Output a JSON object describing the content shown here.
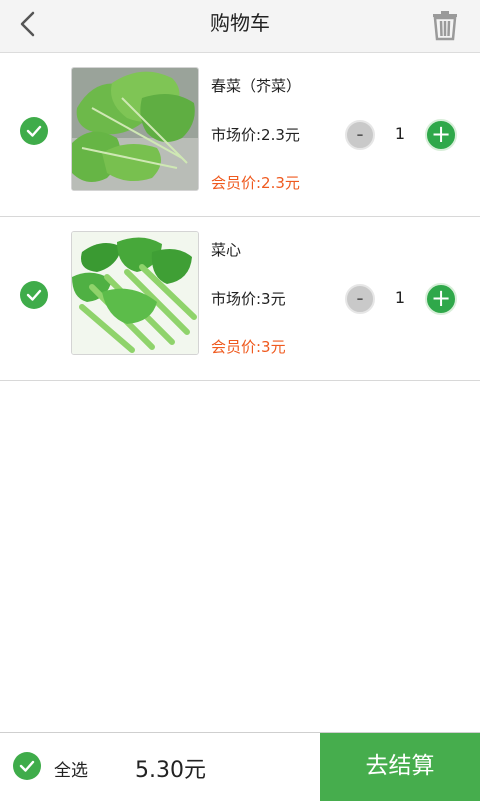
{
  "header": {
    "title": "购物车",
    "back_icon": "back-arrow-icon",
    "delete_icon": "trash-icon"
  },
  "cart": {
    "items": [
      {
        "name": "春菜（芥菜）",
        "market_price": "市场价:2.3元",
        "member_price": "会员价:2.3元",
        "quantity": "1",
        "minus_label": "-",
        "plus_label": "+",
        "checked": true
      },
      {
        "name": "菜心",
        "market_price": "市场价:3元",
        "member_price": "会员价:3元",
        "quantity": "1",
        "minus_label": "-",
        "plus_label": "+",
        "checked": true
      }
    ]
  },
  "footer": {
    "select_all_label": "全选",
    "total": "5.30元",
    "checkout_label": "去结算"
  },
  "colors": {
    "accent_green": "#46ad4d",
    "member_price_orange": "#ef5a1f"
  }
}
